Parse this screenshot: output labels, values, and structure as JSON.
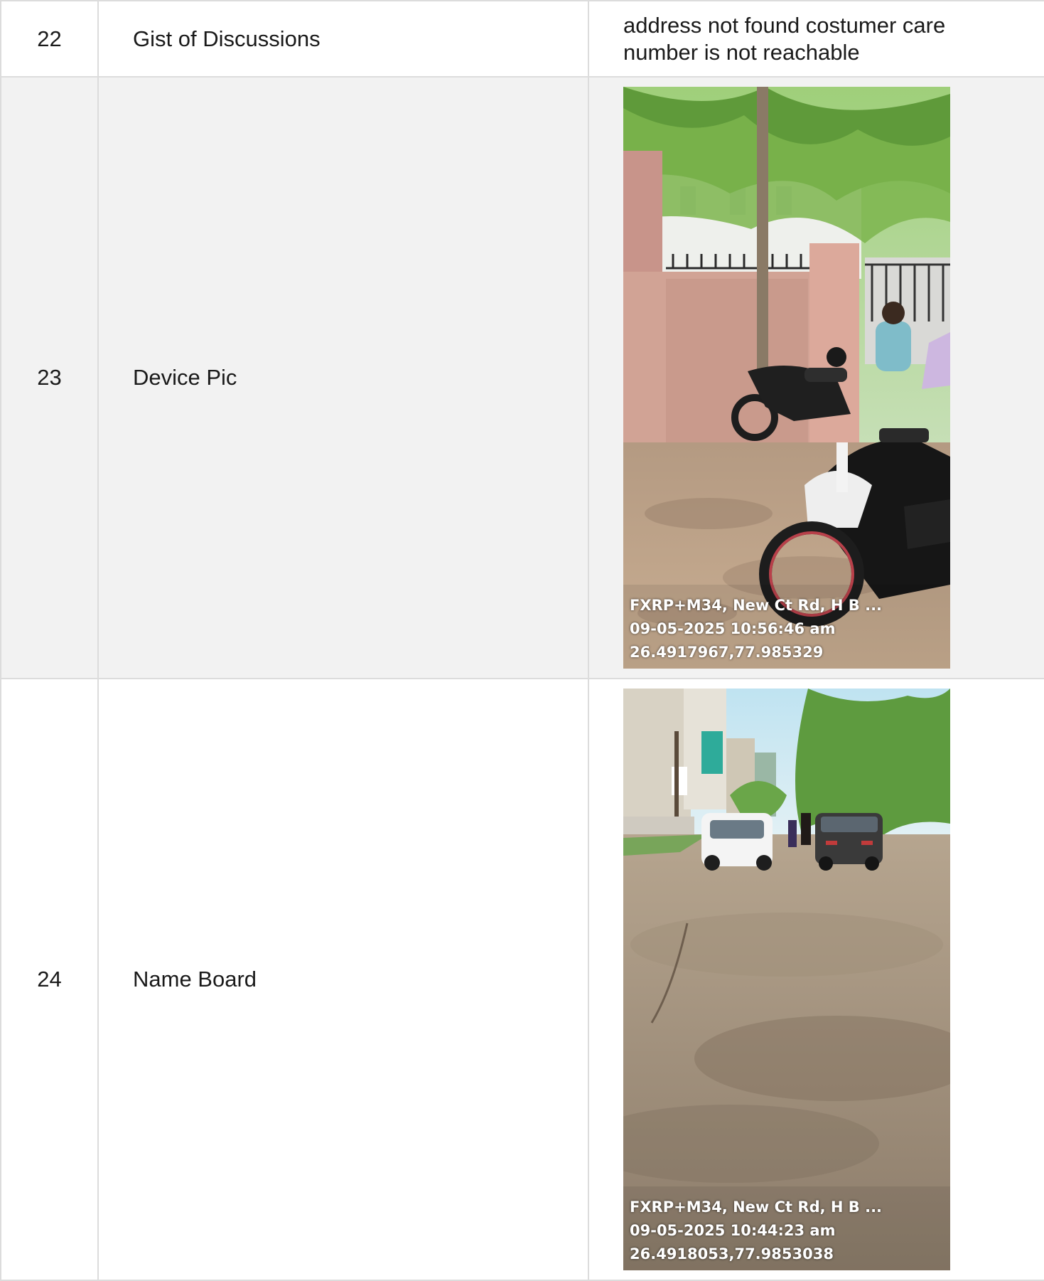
{
  "rows": [
    {
      "number": "22",
      "label": "Gist of Discussions",
      "value": "address not found costumer care number is not reachable"
    },
    {
      "number": "23",
      "label": "Device Pic",
      "photo": {
        "scene": "motorcycles-parked-by-wall",
        "stamp": [
          "FXRP+M34, New Ct Rd, H B ...",
          "09-05-2025 10:56:46 am",
          "26.4917967,77.985329"
        ]
      }
    },
    {
      "number": "24",
      "label": "Name Board",
      "photo": {
        "scene": "street-with-cars",
        "stamp": [
          "FXRP+M34, New Ct Rd, H B ...",
          "09-05-2025 10:44:23 am",
          "26.4918053,77.9853038"
        ]
      }
    }
  ]
}
